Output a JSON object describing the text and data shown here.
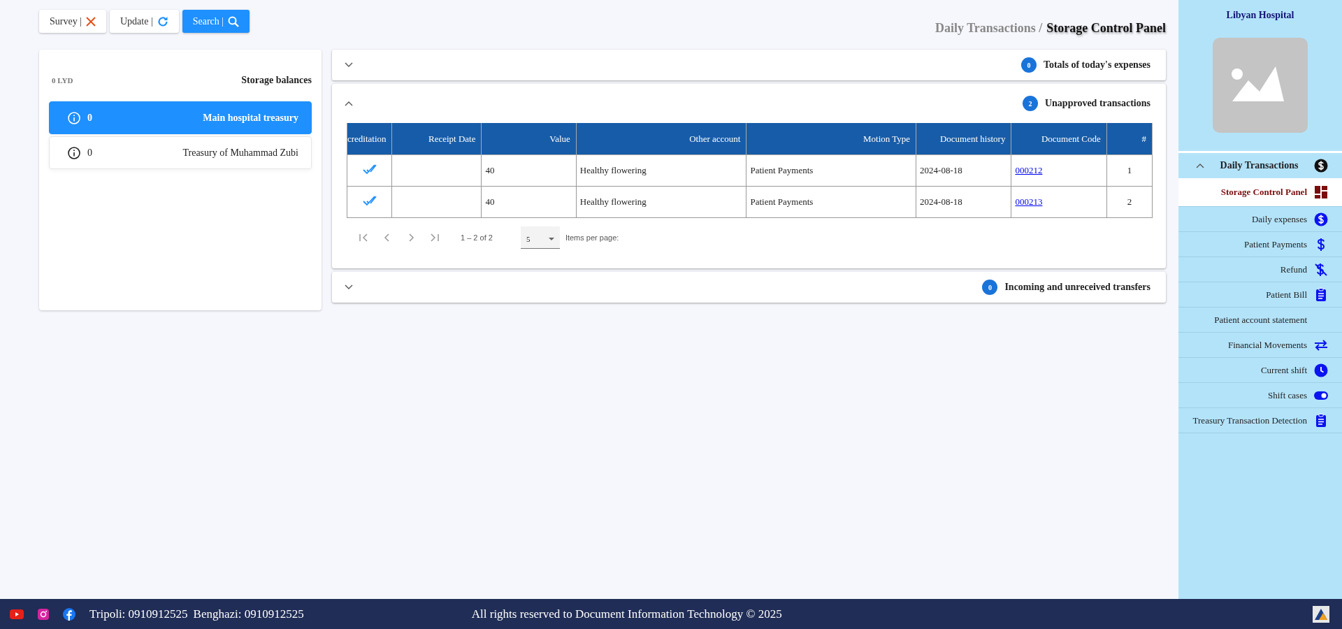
{
  "toolbar": {
    "buttons": [
      {
        "label": "Survey |",
        "kind": "close"
      },
      {
        "label": "Update |",
        "kind": "refresh"
      },
      {
        "label": "Search |",
        "kind": "search"
      }
    ]
  },
  "breadcrumb": {
    "parent": "Daily Transactions /",
    "current": "Storage Control Panel"
  },
  "balances": {
    "total": "0 LYD",
    "title": "Storage balances",
    "items": [
      {
        "amount": "0",
        "name": "Main hospital treasury",
        "selected": true
      },
      {
        "amount": "0",
        "name": "Treasury of Muhammad Zubi",
        "selected": false
      }
    ]
  },
  "panels": [
    {
      "title": "Totals of today's expenses",
      "count": "0",
      "expanded": false
    },
    {
      "title": "Unapproved transactions",
      "count": "2",
      "expanded": true,
      "table": {
        "columns": [
          "creditation",
          "Receipt Date",
          "Value",
          "Other account",
          "Motion Type",
          "Document history",
          "Document Code",
          "#"
        ],
        "rows": [
          {
            "approved": true,
            "receipt_date": "",
            "value": "40",
            "other_account": "Healthy flowering",
            "motion_type": "Patient Payments",
            "document_history": "2024-08-18",
            "document_code": "000212",
            "number": "1"
          },
          {
            "approved": true,
            "receipt_date": "",
            "value": "40",
            "other_account": "Healthy flowering",
            "motion_type": "Patient Payments",
            "document_history": "2024-08-18",
            "document_code": "000213",
            "number": "2"
          }
        ]
      },
      "paginator": {
        "range": "1 – 2 of 2",
        "page_size": "5",
        "page_size_label": "Items per page:"
      }
    },
    {
      "title": "Incoming and unreceived transfers",
      "count": "0",
      "expanded": false
    }
  ],
  "sidebar": {
    "title": "Libyan Hospital",
    "group": {
      "label": "Daily Transactions",
      "expanded": true,
      "children": [
        {
          "label": "Storage Control Panel",
          "kind": "dashboard",
          "selected": true
        },
        {
          "label": "Daily expenses",
          "kind": "coin",
          "selected": false
        },
        {
          "label": "Patient Payments",
          "kind": "dollar",
          "selected": false
        },
        {
          "label": "Refund",
          "kind": "nodollar",
          "selected": false
        },
        {
          "label": "Patient Bill",
          "kind": "clipboard",
          "selected": false
        },
        {
          "label": "Patient account statement",
          "kind": "none",
          "selected": false
        },
        {
          "label": "Financial Movements",
          "kind": "swap",
          "selected": false
        },
        {
          "label": "Current shift",
          "kind": "clock",
          "selected": false
        },
        {
          "label": "Shift cases",
          "kind": "toggle",
          "selected": false
        },
        {
          "label": "Treasury Transaction Detection",
          "kind": "clipboard",
          "selected": false
        }
      ]
    }
  },
  "footer": {
    "contacts": [
      "Tripoli: 0910912525",
      "Benghazi: 0910912525"
    ],
    "copyright": "All rights reserved to Document Information Technology © 2025"
  }
}
